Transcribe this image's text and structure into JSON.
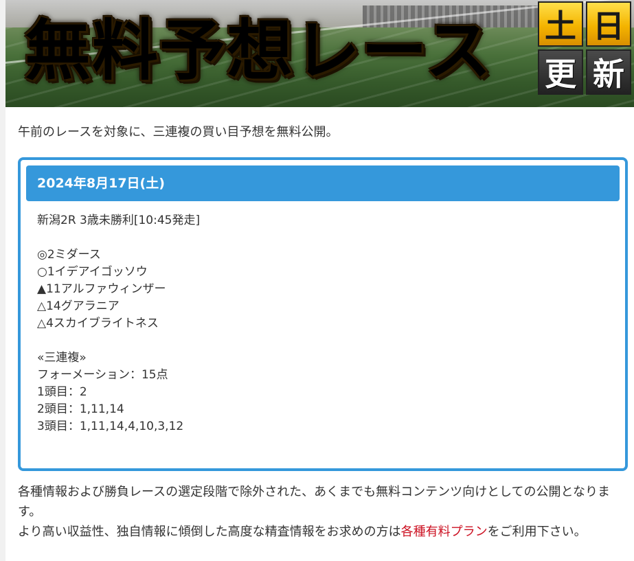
{
  "hero": {
    "title": "無料予想レース",
    "badges": [
      "土",
      "日",
      "更",
      "新"
    ]
  },
  "intro": "午前のレースを対象に、三連複の買い目予想を無料公開。",
  "card": {
    "date": "2024年8月17日(土)",
    "race": "新潟2R 3歳未勝利[10:45発走]",
    "picks": [
      "◎2ミダース",
      "○1イデアイゴッソウ",
      "▲11アルファウィンザー",
      "△14グアラニア",
      "△4スカイブライトネス"
    ],
    "bet_type": "«三連複»",
    "formation": "フォーメーション：15点",
    "legs": [
      "1頭目：2",
      "2頭目：1,11,14",
      "3頭目：1,11,14,4,10,3,12"
    ]
  },
  "footer": {
    "line1": "各種情報および勝負レースの選定段階で除外された、あくまでも無料コンテンツ向けとしての公開となります。",
    "line2_before": "より高い収益性、独自情報に傾倒した高度な精査情報をお求めの方は",
    "line2_link": "各種有料プラン",
    "line2_after": "をご利用下さい。"
  },
  "colors": {
    "accent": "#3598db",
    "link": "#cc1122",
    "badge_gold": "#f4b400"
  }
}
